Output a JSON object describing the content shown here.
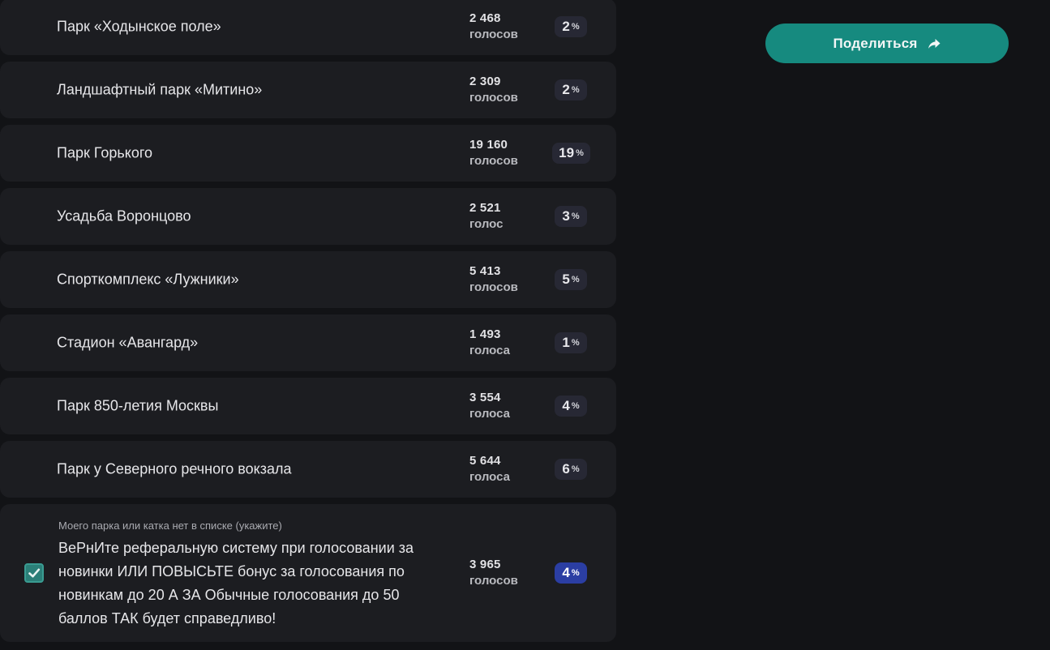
{
  "share": {
    "label": "Поделиться",
    "icon": "share-arrow-icon"
  },
  "options": [
    {
      "name": "Парк «Ходынское поле»",
      "votes": "2 468",
      "unit": "голосов",
      "percent": "2",
      "percent_sign": "%"
    },
    {
      "name": "Ландшафтный парк «Митино»",
      "votes": "2 309",
      "unit": "голосов",
      "percent": "2",
      "percent_sign": "%"
    },
    {
      "name": "Парк Горького",
      "votes": "19 160",
      "unit": "голосов",
      "percent": "19",
      "percent_sign": "%"
    },
    {
      "name": "Усадьба Воронцово",
      "votes": "2 521",
      "unit": "голос",
      "percent": "3",
      "percent_sign": "%"
    },
    {
      "name": "Спорткомплекс «Лужники»",
      "votes": "5 413",
      "unit": "голосов",
      "percent": "5",
      "percent_sign": "%"
    },
    {
      "name": "Стадион «Авангард»",
      "votes": "1 493",
      "unit": "голоса",
      "percent": "1",
      "percent_sign": "%"
    },
    {
      "name": "Парк 850-летия Москвы",
      "votes": "3 554",
      "unit": "голоса",
      "percent": "4",
      "percent_sign": "%"
    },
    {
      "name": "Парк у Северного речного вокзала",
      "votes": "5 644",
      "unit": "голоса",
      "percent": "6",
      "percent_sign": "%"
    }
  ],
  "custom_option": {
    "hint": "Моего парка или катка нет в списке (укажите)",
    "text": "ВеРнИте реферальную систему при голосовании за новинки ИЛИ ПОВЫСЬТЕ бонус за голосования по новинкам до 20 А ЗА Обычные голосования до 50 баллов ТАК будет справедливо!",
    "votes": "3 965",
    "unit": "голосов",
    "percent": "4",
    "percent_sign": "%",
    "checked": true,
    "icon": "checkmark-icon"
  },
  "colors": {
    "background": "#121316",
    "row": "#1c1d21",
    "accent": "#168a7f",
    "selected_badge": "#2b3ea3"
  }
}
